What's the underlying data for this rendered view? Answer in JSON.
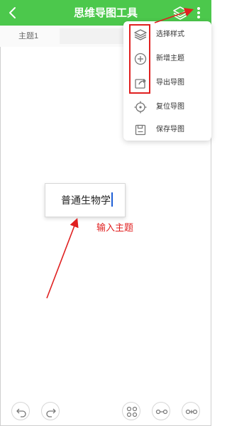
{
  "app": {
    "title": "思维导图工具",
    "accent_color": "#4cc84c",
    "annotation_color": "#e02020"
  },
  "header": {
    "back_icon": "chevron-left-icon",
    "layers_icon": "layers-icon",
    "more_icon": "more-vertical-icon"
  },
  "tabs": [
    {
      "label": "主题1"
    }
  ],
  "menu": {
    "items": [
      {
        "label": "选择样式",
        "icon": "layers-icon"
      },
      {
        "label": "新增主题",
        "icon": "plus-circle-icon"
      },
      {
        "label": "导出导图",
        "icon": "share-icon"
      },
      {
        "label": "复位导图",
        "icon": "locate-icon"
      },
      {
        "label": "保存导图",
        "icon": "save-icon"
      }
    ]
  },
  "canvas": {
    "root_node_text": "普通生物学",
    "annotation_text": "输入主题"
  },
  "bottom_toolbar": {
    "items": [
      {
        "icon": "undo-icon"
      },
      {
        "icon": "redo-icon"
      },
      {
        "icon": "node-layout-icon"
      },
      {
        "icon": "add-sibling-icon"
      },
      {
        "icon": "add-child-icon"
      }
    ]
  }
}
